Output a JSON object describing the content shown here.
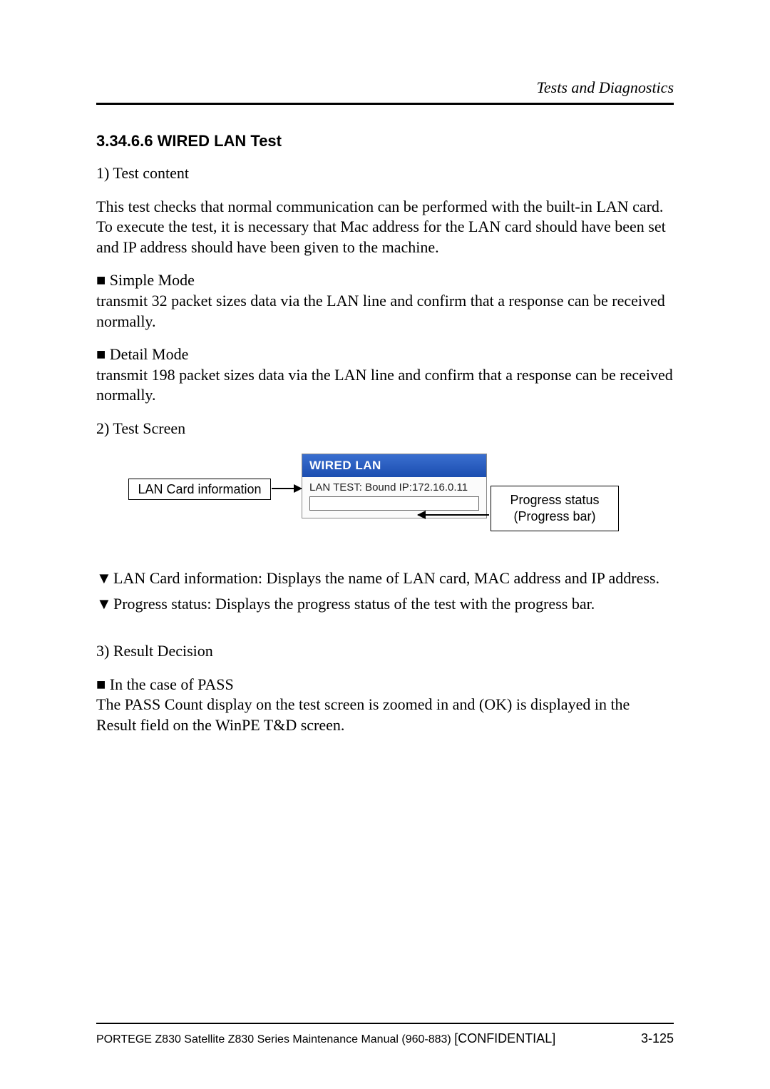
{
  "header": {
    "section": "Tests and Diagnostics"
  },
  "title": "3.34.6.6   WIRED LAN Test",
  "p1_label": "1) Test content",
  "p1_text": "This test checks that normal communication can be performed with the built-in LAN card. To execute the test, it is necessary that Mac address for the LAN card should have been set and IP address should have been given to the machine.",
  "simple_mode_label": "■ Simple Mode",
  "simple_mode_text": "transmit 32 packet sizes data via the LAN line and confirm that a response can be received normally.",
  "detail_mode_label": "■ Detail Mode",
  "detail_mode_text": "transmit 198 packet sizes data via the LAN line and confirm that a response can be received normally.",
  "p2_label": "2) Test Screen",
  "diagram": {
    "lan_info": "LAN Card information",
    "header": "WIRED LAN",
    "lan_test": "LAN TEST: Bound IP:172.16.0.11",
    "progress_line1": "Progress status",
    "progress_line2": "(Progress bar)"
  },
  "bullets": {
    "b1": "LAN Card information: Displays the name of LAN card, MAC address and IP address.",
    "b2": "Progress status: Displays the progress status of the test with the progress bar."
  },
  "p3_label": "3) Result Decision",
  "pass_label": "■ In the case of PASS",
  "pass_text": "The PASS Count display on the test screen is zoomed in and (OK) is displayed in the Result field on the WinPE T&D screen.",
  "footer": {
    "manual": "PORTEGE Z830 Satellite Z830 Series Maintenance Manual (960-883) ",
    "confidential": "[CONFIDENTIAL]",
    "page": "3-125"
  }
}
